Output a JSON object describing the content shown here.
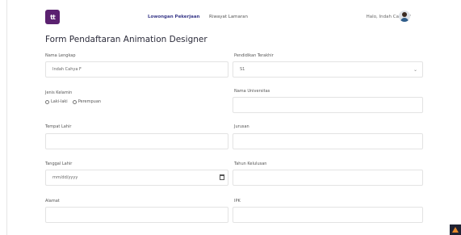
{
  "nav": {
    "logo_text": "tt",
    "links": [
      "Lowongan Pekerjaan",
      "Riwayat Lamaran"
    ],
    "greeting": "Halo, Indah Cahya F"
  },
  "form": {
    "title": "Form Pendaftaran Animation Designer",
    "nama_label": "Nama Lengkap",
    "nama_value": "Indah Cahya F",
    "pendidikan_label": "Pendidikan Terakhir",
    "pendidikan_value": "S1",
    "jk_label": "Jenis Kelamin",
    "jk_options": [
      "Laki-laki",
      "Perempuan"
    ],
    "universitas_label": "Nama Universitas",
    "tempat_label": "Tempat Lahir",
    "jurusan_label": "Jurusan",
    "tanggal_label": "Tanggal Lahir",
    "tanggal_placeholder": "mm/dd/yyyy",
    "tahun_label": "Tahun Kelulusan",
    "alamat_label": "Alamat",
    "ipk_label": "IPK"
  },
  "colors": {
    "brand": "#5b2170",
    "nav_active": "#3b3b8a"
  }
}
